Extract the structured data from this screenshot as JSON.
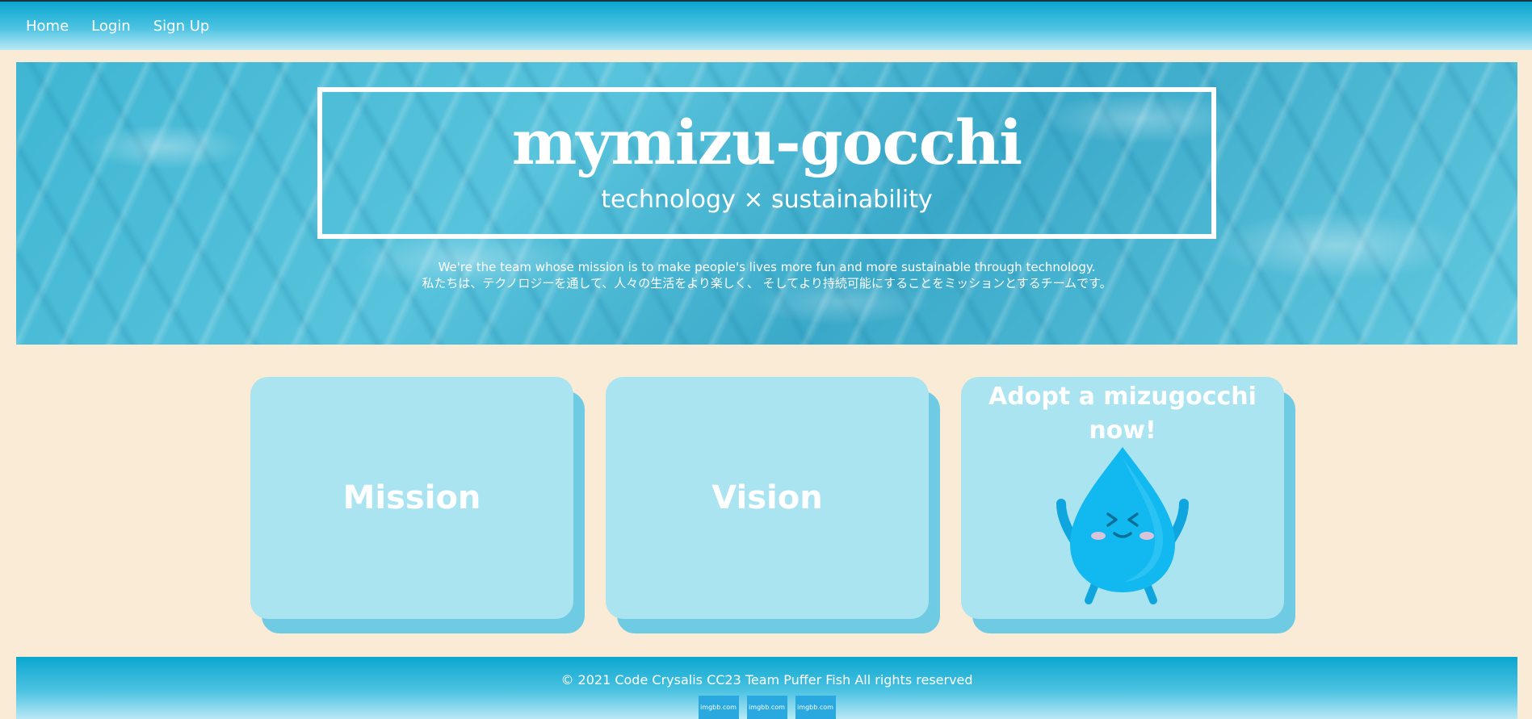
{
  "nav": {
    "items": [
      {
        "label": "Home"
      },
      {
        "label": "Login"
      },
      {
        "label": "Sign Up"
      }
    ]
  },
  "hero": {
    "title": "mymizu-gocchi",
    "tagline": "technology × sustainability",
    "intro_en": "We're the team whose mission is to make people's lives more fun and more sustainable through technology.",
    "intro_ja": "私たちは、テクノロジーを通して、人々の生活をより楽しく、 そしてより持続可能にすることをミッションとするチームです。"
  },
  "cards": {
    "mission": "Mission",
    "vision": "Vision",
    "adopt": "Adopt a mizugocchi now!"
  },
  "footer": {
    "copyright": "© 2021 Code Crysalis CC23 Team Puffer Fish All rights reserved",
    "badges": [
      "imgbb.com",
      "imgbb.com",
      "imgbb.com"
    ]
  },
  "colors": {
    "page_bg": "#faebd7",
    "card": "#a9e4f0",
    "card_shadow": "#6fcbe3",
    "nav_gradient_top": "#0aa6cf",
    "mascot": "#12b8f0"
  }
}
